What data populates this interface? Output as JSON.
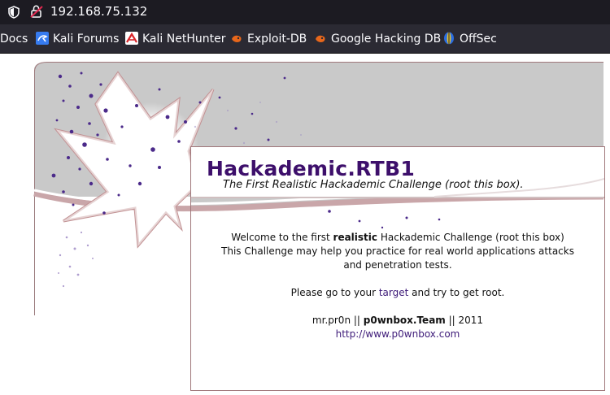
{
  "browser": {
    "url": "192.168.75.132",
    "bookmarks": [
      {
        "label": "Docs",
        "icon": "none"
      },
      {
        "label": "Kali Forums",
        "icon": "kali-icon"
      },
      {
        "label": "Kali NetHunter",
        "icon": "nethunter-icon"
      },
      {
        "label": "Exploit-DB",
        "icon": "exploit-db-icon"
      },
      {
        "label": "Google Hacking DB",
        "icon": "ghdb-icon"
      },
      {
        "label": "OffSec",
        "icon": "offsec-icon"
      }
    ]
  },
  "page": {
    "title": "Hackademic.RTB1",
    "subtitle": "The First Realistic Hackademic Challenge (root this box).",
    "welcome_prefix": "Welcome to the first ",
    "welcome_bold": "realistic",
    "welcome_suffix": " Hackademic Challenge (root this box)",
    "line2": "This Challenge may help you practice for real world applications attacks and penetration tests.",
    "goto_prefix": "Please go to your ",
    "goto_link": "target",
    "goto_suffix": " and try to get root.",
    "credit_prefix": "mr.pr0n || ",
    "credit_bold": "p0wnbox.Team",
    "credit_suffix": " || 2011",
    "website_link": "http://www.p0wnbox.com"
  },
  "colors": {
    "title": "#3d0f6b",
    "link": "#3d1a78",
    "chrome_dark": "#1c1b22",
    "toolbar": "#2b2a33",
    "border": "#a0777a"
  }
}
